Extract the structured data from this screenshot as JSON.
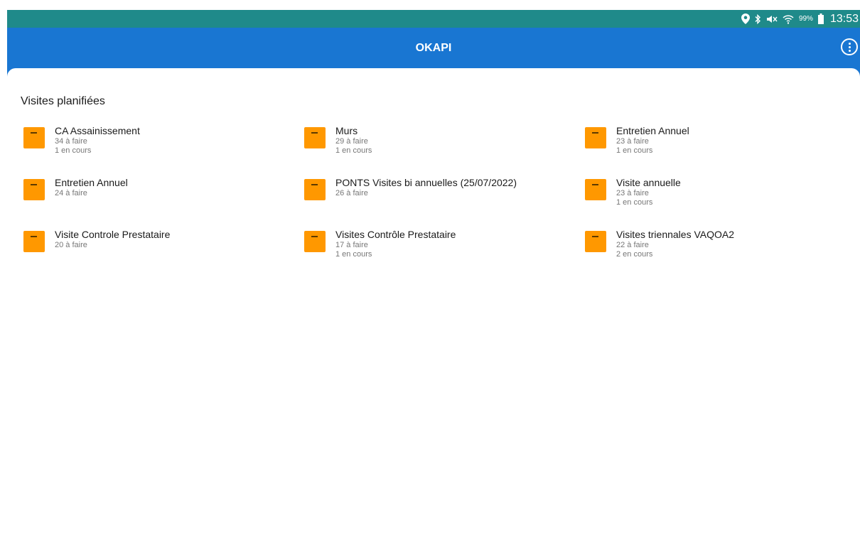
{
  "status_bar": {
    "battery_percent": "99%",
    "time": "13:53",
    "icons": [
      "location-icon",
      "bluetooth-icon",
      "mute-icon",
      "wifi-icon",
      "battery-icon"
    ]
  },
  "app_bar": {
    "title": "OKAPI",
    "menu_icon": "more-vert-icon",
    "color": "#1976d2"
  },
  "section": {
    "title": "Visites planifiées"
  },
  "folder_color": "#ff9800",
  "items": [
    {
      "name": "CA Assainissement",
      "todo": "34 à faire",
      "in_progress": "1 en cours"
    },
    {
      "name": "Murs",
      "todo": "29 à faire",
      "in_progress": "1 en cours"
    },
    {
      "name": "Entretien Annuel",
      "todo": "23 à faire",
      "in_progress": "1 en cours"
    },
    {
      "name": "Entretien Annuel",
      "todo": "24 à faire",
      "in_progress": ""
    },
    {
      "name": "PONTS Visites bi annuelles (25/07/2022)",
      "todo": "26 à faire",
      "in_progress": ""
    },
    {
      "name": "Visite annuelle",
      "todo": "23 à faire",
      "in_progress": "1 en cours"
    },
    {
      "name": "Visite Controle Prestataire",
      "todo": "20 à faire",
      "in_progress": ""
    },
    {
      "name": "Visites Contrôle Prestataire",
      "todo": "17 à faire",
      "in_progress": "1 en cours"
    },
    {
      "name": "Visites triennales VAQOA2",
      "todo": "22 à faire",
      "in_progress": "2 en cours"
    }
  ]
}
